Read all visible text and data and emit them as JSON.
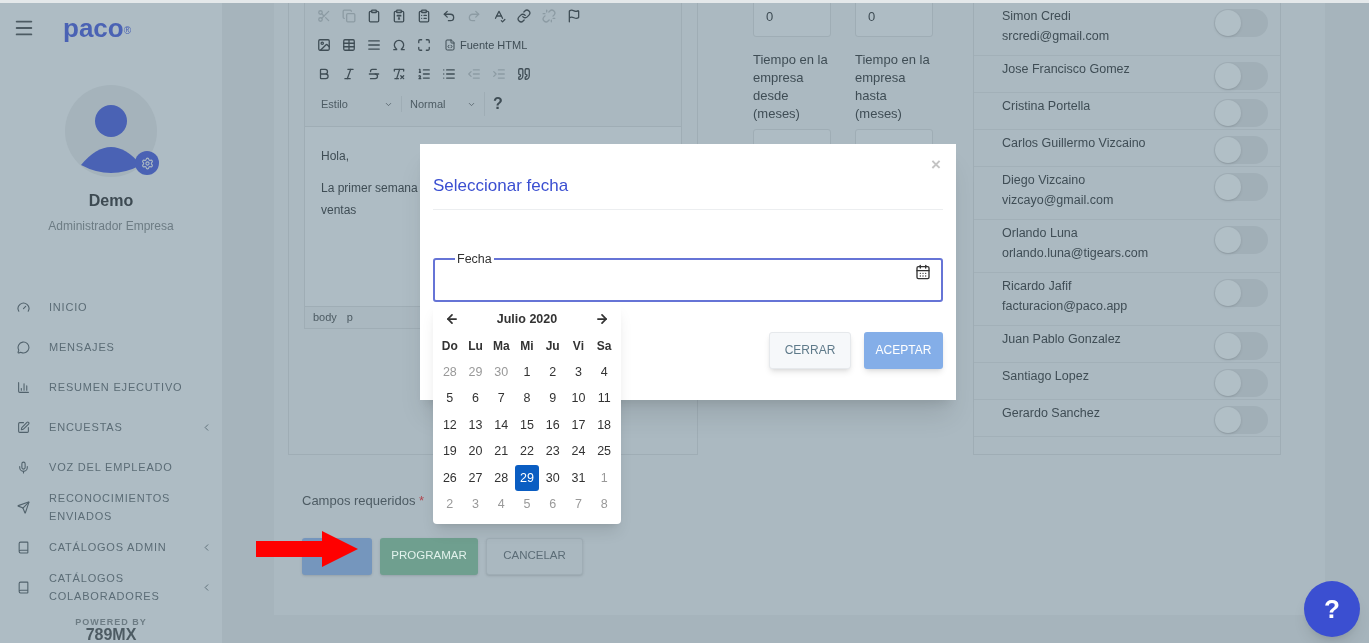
{
  "sidebar": {
    "logo": "paco",
    "logo_mark": "®",
    "user_name": "Demo",
    "user_role": "Administrador Empresa",
    "items": [
      {
        "label": "INICIO",
        "submenu": false
      },
      {
        "label": "MENSAJES",
        "submenu": false
      },
      {
        "label": "RESUMEN EJECUTIVO",
        "submenu": false
      },
      {
        "label": "ENCUESTAS",
        "submenu": true
      },
      {
        "label": "VOZ DEL EMPLEADO",
        "submenu": false
      },
      {
        "label": "RECONOCIMIENTOS ENVIADOS",
        "submenu": false
      },
      {
        "label": "CATÁLOGOS ADMIN",
        "submenu": true
      },
      {
        "label": "CATÁLOGOS COLABORADORES",
        "submenu": true
      }
    ],
    "powered_by": "POWERED BY",
    "powered_brand": "789MX"
  },
  "editor": {
    "toolbar_rows": [
      [
        {
          "disabled": true
        },
        {
          "disabled": true
        },
        {
          "disabled": false
        },
        {
          "disabled": false
        },
        {
          "disabled": false
        },
        {
          "disabled": false
        },
        {
          "disabled": true
        },
        {
          "disabled": false
        },
        {
          "disabled": false
        },
        {
          "disabled": true
        },
        {
          "disabled": false
        }
      ],
      [
        {
          "disabled": false
        },
        {
          "disabled": false
        },
        {
          "disabled": false
        },
        {
          "disabled": false
        },
        {
          "disabled": false
        }
      ],
      [
        {
          "disabled": false
        },
        {
          "disabled": false
        },
        {
          "disabled": false
        },
        {
          "disabled": false
        },
        {
          "disabled": false
        },
        {
          "disabled": false
        },
        {
          "disabled": true
        },
        {
          "disabled": true
        },
        {
          "disabled": false
        }
      ]
    ],
    "source_button": "Fuente HTML",
    "style_dropdown": "Estilo",
    "format_dropdown": "Normal",
    "help": "?",
    "body_lines": [
      "Hola,",
      "La primer semana",
      "ventas"
    ],
    "path": [
      "body",
      "p"
    ]
  },
  "filters": {
    "inputs": [
      {
        "value": "0"
      },
      {
        "value": "0"
      }
    ],
    "labels": [
      "Tiempo en la empresa desde (meses)",
      "Tiempo en la empresa hasta (meses)"
    ]
  },
  "recipients": [
    {
      "name": "Simon Credi",
      "email": "srcredi@gmail.com",
      "on": false
    },
    {
      "name": "Jose Francisco Gomez",
      "on": false
    },
    {
      "name": "Cristina Portella",
      "on": false
    },
    {
      "name": "Carlos Guillermo Vizcaino",
      "on": false
    },
    {
      "name": "Diego Vizcaino",
      "email": "vizcayo@gmail.com",
      "on": false
    },
    {
      "name": "Orlando Luna",
      "email": "orlando.luna@tigears.com",
      "on": false
    },
    {
      "name": "Ricardo Jafif",
      "email": "facturacion@paco.app",
      "on": false
    },
    {
      "name": "Juan Pablo Gonzalez",
      "on": false
    },
    {
      "name": "Santiago Lopez",
      "on": false
    },
    {
      "name": "Gerardo Sanchez",
      "on": false
    }
  ],
  "form": {
    "required_note": "Campos requeridos",
    "required_mark": "*",
    "buttons": [
      {
        "kind": "primary"
      },
      {
        "kind": "success",
        "label": "PROGRAMAR"
      },
      {
        "kind": "default",
        "label": "CANCELAR"
      }
    ]
  },
  "modal": {
    "title": "Seleccionar fecha",
    "close": "×",
    "field_label": "Fecha",
    "buttons": [
      {
        "kind": "secondary",
        "label": "CERRAR"
      },
      {
        "kind": "primary",
        "label": "ACEPTAR"
      }
    ]
  },
  "datepicker": {
    "month": "Julio 2020",
    "weekdays": [
      "Do",
      "Lu",
      "Ma",
      "Mi",
      "Ju",
      "Vi",
      "Sa"
    ],
    "weeks": [
      [
        {
          "day": "28",
          "outside": true,
          "selected": false
        },
        {
          "day": "29",
          "outside": true,
          "selected": false
        },
        {
          "day": "30",
          "outside": true,
          "selected": false
        },
        {
          "day": "1",
          "outside": false,
          "selected": false
        },
        {
          "day": "2",
          "outside": false,
          "selected": false
        },
        {
          "day": "3",
          "outside": false,
          "selected": false
        },
        {
          "day": "4",
          "outside": false,
          "selected": false
        }
      ],
      [
        {
          "day": "5",
          "outside": false,
          "selected": false
        },
        {
          "day": "6",
          "outside": false,
          "selected": false
        },
        {
          "day": "7",
          "outside": false,
          "selected": false
        },
        {
          "day": "8",
          "outside": false,
          "selected": false
        },
        {
          "day": "9",
          "outside": false,
          "selected": false
        },
        {
          "day": "10",
          "outside": false,
          "selected": false
        },
        {
          "day": "11",
          "outside": false,
          "selected": false
        }
      ],
      [
        {
          "day": "12",
          "outside": false,
          "selected": false
        },
        {
          "day": "13",
          "outside": false,
          "selected": false
        },
        {
          "day": "14",
          "outside": false,
          "selected": false
        },
        {
          "day": "15",
          "outside": false,
          "selected": false
        },
        {
          "day": "16",
          "outside": false,
          "selected": false
        },
        {
          "day": "17",
          "outside": false,
          "selected": false
        },
        {
          "day": "18",
          "outside": false,
          "selected": false
        }
      ],
      [
        {
          "day": "19",
          "outside": false,
          "selected": false
        },
        {
          "day": "20",
          "outside": false,
          "selected": false
        },
        {
          "day": "21",
          "outside": false,
          "selected": false
        },
        {
          "day": "22",
          "outside": false,
          "selected": false
        },
        {
          "day": "23",
          "outside": false,
          "selected": false
        },
        {
          "day": "24",
          "outside": false,
          "selected": false
        },
        {
          "day": "25",
          "outside": false,
          "selected": false
        }
      ],
      [
        {
          "day": "26",
          "outside": false,
          "selected": false
        },
        {
          "day": "27",
          "outside": false,
          "selected": false
        },
        {
          "day": "28",
          "outside": false,
          "selected": false
        },
        {
          "day": "29",
          "outside": false,
          "selected": true
        },
        {
          "day": "30",
          "outside": false,
          "selected": false
        },
        {
          "day": "31",
          "outside": false,
          "selected": false
        },
        {
          "day": "1",
          "outside": true,
          "selected": false
        }
      ],
      [
        {
          "day": "2",
          "outside": true,
          "selected": false
        },
        {
          "day": "3",
          "outside": true,
          "selected": false
        },
        {
          "day": "4",
          "outside": true,
          "selected": false
        },
        {
          "day": "5",
          "outside": true,
          "selected": false
        },
        {
          "day": "6",
          "outside": true,
          "selected": false
        },
        {
          "day": "7",
          "outside": true,
          "selected": false
        },
        {
          "day": "8",
          "outside": true,
          "selected": false
        }
      ]
    ]
  },
  "help_button": "?"
}
